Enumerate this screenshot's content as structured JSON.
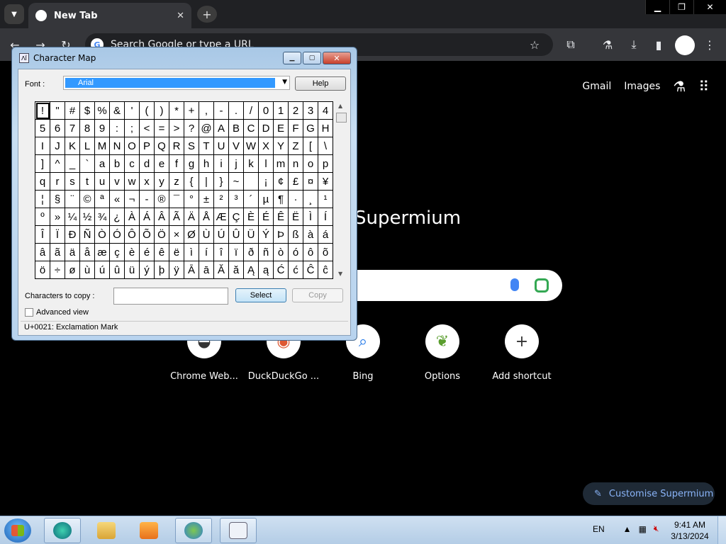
{
  "browser": {
    "tab_title": "New Tab",
    "omnibox_placeholder": "Search Google or type a URL",
    "ntp_links": [
      "Gmail",
      "Images"
    ],
    "ntp_title": "Supermium",
    "shortcuts": [
      {
        "label": "Chrome Web...",
        "icon": "chrome-webstore-icon"
      },
      {
        "label": "DuckDuckGo ...",
        "icon": "duckduckgo-icon"
      },
      {
        "label": "Bing",
        "icon": "bing-search-icon"
      },
      {
        "label": "Options",
        "icon": "options-plant-icon"
      },
      {
        "label": "Add shortcut",
        "icon": "plus-icon"
      }
    ],
    "customise_label": "Customise Supermium"
  },
  "charmap": {
    "title": "Character Map",
    "font_label": "Font :",
    "font_value": "Arial",
    "help_label": "Help",
    "characters": [
      [
        "!",
        "\"",
        "#",
        "$",
        "%",
        "&",
        "'",
        "(",
        ")",
        "*",
        "+",
        ",",
        "-",
        ".",
        "/",
        "0",
        "1",
        "2",
        "3",
        "4"
      ],
      [
        "5",
        "6",
        "7",
        "8",
        "9",
        ":",
        ";",
        "<",
        "=",
        ">",
        "?",
        "@",
        "A",
        "B",
        "C",
        "D",
        "E",
        "F",
        "G",
        "H"
      ],
      [
        "I",
        "J",
        "K",
        "L",
        "M",
        "N",
        "O",
        "P",
        "Q",
        "R",
        "S",
        "T",
        "U",
        "V",
        "W",
        "X",
        "Y",
        "Z",
        "[",
        "\\"
      ],
      [
        "]",
        "^",
        "_",
        "`",
        "a",
        "b",
        "c",
        "d",
        "e",
        "f",
        "g",
        "h",
        "i",
        "j",
        "k",
        "l",
        "m",
        "n",
        "o",
        "p"
      ],
      [
        "q",
        "r",
        "s",
        "t",
        "u",
        "v",
        "w",
        "x",
        "y",
        "z",
        "{",
        "|",
        "}",
        "~",
        " ",
        "¡",
        "¢",
        "£",
        "¤",
        "¥"
      ],
      [
        "¦",
        "§",
        "¨",
        "©",
        "ª",
        "«",
        "¬",
        "-",
        "®",
        "¯",
        "°",
        "±",
        "²",
        "³",
        "´",
        "µ",
        "¶",
        "·",
        "¸",
        "¹"
      ],
      [
        "º",
        "»",
        "¼",
        "½",
        "¾",
        "¿",
        "À",
        "Á",
        "Â",
        "Ã",
        "Ä",
        "Å",
        "Æ",
        "Ç",
        "È",
        "É",
        "Ê",
        "Ë",
        "Ì",
        "Í"
      ],
      [
        "Î",
        "Ï",
        "Ð",
        "Ñ",
        "Ò",
        "Ó",
        "Ô",
        "Õ",
        "Ö",
        "×",
        "Ø",
        "Ù",
        "Ú",
        "Û",
        "Ü",
        "Ý",
        "Þ",
        "ß",
        "à",
        "á"
      ],
      [
        "â",
        "ã",
        "ä",
        "å",
        "æ",
        "ç",
        "è",
        "é",
        "ê",
        "ë",
        "ì",
        "í",
        "î",
        "ï",
        "ð",
        "ñ",
        "ò",
        "ó",
        "ô",
        "õ"
      ],
      [
        "ö",
        "÷",
        "ø",
        "ù",
        "ú",
        "û",
        "ü",
        "ý",
        "þ",
        "ÿ",
        "Ā",
        "ā",
        "Ă",
        "ă",
        "Ą",
        "ą",
        "Ć",
        "ć",
        "Ĉ",
        "ĉ"
      ]
    ],
    "copy_label": "Characters to copy :",
    "copy_value": "",
    "select_label": "Select",
    "copy_button_label": "Copy",
    "advanced_label": "Advanced view",
    "advanced_checked": false,
    "status": "U+0021: Exclamation Mark"
  },
  "taskbar": {
    "apps": [
      "edge-icon",
      "explorer-icon",
      "media-player-icon",
      "users-icon",
      "charmap-icon"
    ],
    "language": "EN",
    "time": "9:41 AM",
    "date": "3/13/2024"
  }
}
